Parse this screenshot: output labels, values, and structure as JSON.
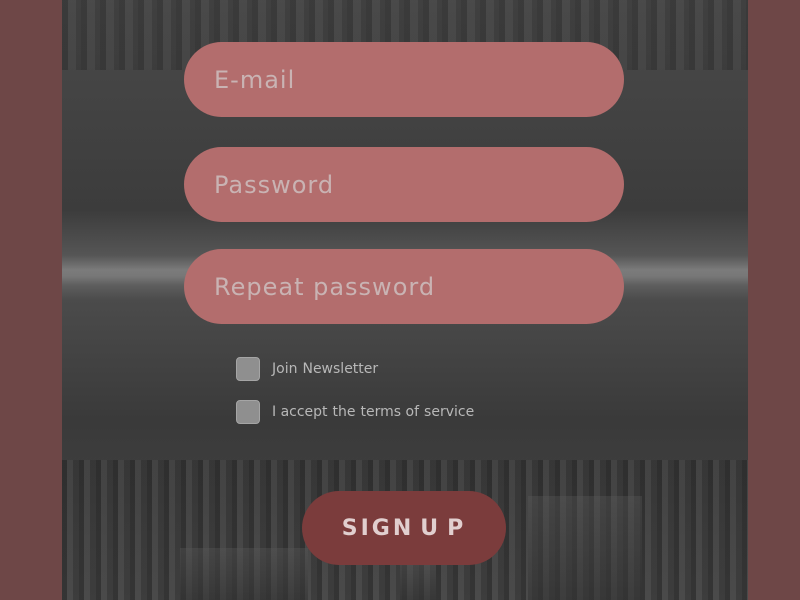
{
  "form": {
    "email_placeholder": "E-mail",
    "password_placeholder": "Password",
    "repeat_placeholder": "Repeat password"
  },
  "options": {
    "newsletter": [
      "Join",
      "Newsletter"
    ],
    "terms": [
      "I accept",
      "the",
      "terms of",
      "service"
    ]
  },
  "action": {
    "signup_parts": [
      "SIGN",
      "U",
      "P"
    ]
  },
  "colors": {
    "field_bg": "#b36d6d",
    "button_bg": "#7b3c3c",
    "frame": "#6e4747"
  }
}
